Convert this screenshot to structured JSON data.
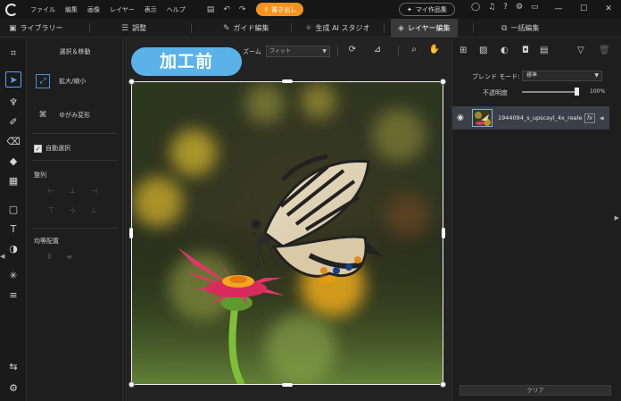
{
  "menu": [
    "ファイル",
    "編集",
    "画像",
    "レイヤー",
    "表示",
    "ヘルプ"
  ],
  "toolbar": {
    "save_icon": "save-icon",
    "undo_icon": "undo-icon",
    "redo_icon": "redo-icon",
    "export_label": "書き出し",
    "my_works_label": "マイ作品集"
  },
  "tabs": [
    {
      "label": "ライブラリー",
      "icon": "library-icon"
    },
    {
      "label": "調整",
      "icon": "adjust-icon"
    },
    {
      "label": "ガイド編集",
      "icon": "guide-icon"
    },
    {
      "label": "生成 AI スタジオ",
      "icon": "ai-sparkle-icon"
    },
    {
      "label": "レイヤー編集",
      "icon": "layers-icon"
    },
    {
      "label": "一括編集",
      "icon": "batch-icon"
    }
  ],
  "options": {
    "title": "選択＆移動",
    "scale_label": "拡大/縮小",
    "warp_label": "ゆがみ変形",
    "auto_select_label": "自動選択",
    "align_label": "整列",
    "distribute_label": "均等配置"
  },
  "canvas": {
    "before_badge": "加工前",
    "zoom_label": "ズーム",
    "zoom_value": "フィット"
  },
  "layers": {
    "blend_label": "ブレンド モード:",
    "blend_value": "標準",
    "opacity_label": "不透明度",
    "opacity_value": "100%",
    "opacity_fraction": 1.0,
    "layer_name": "1944094_s_upscayl_4x_realesr...",
    "fx_label": "fx",
    "clear_label": "クリア"
  },
  "colors": {
    "accent_orange": "#f6931e",
    "accent_blue": "#5ab2e8",
    "selection_blue": "#5aa5ff"
  }
}
